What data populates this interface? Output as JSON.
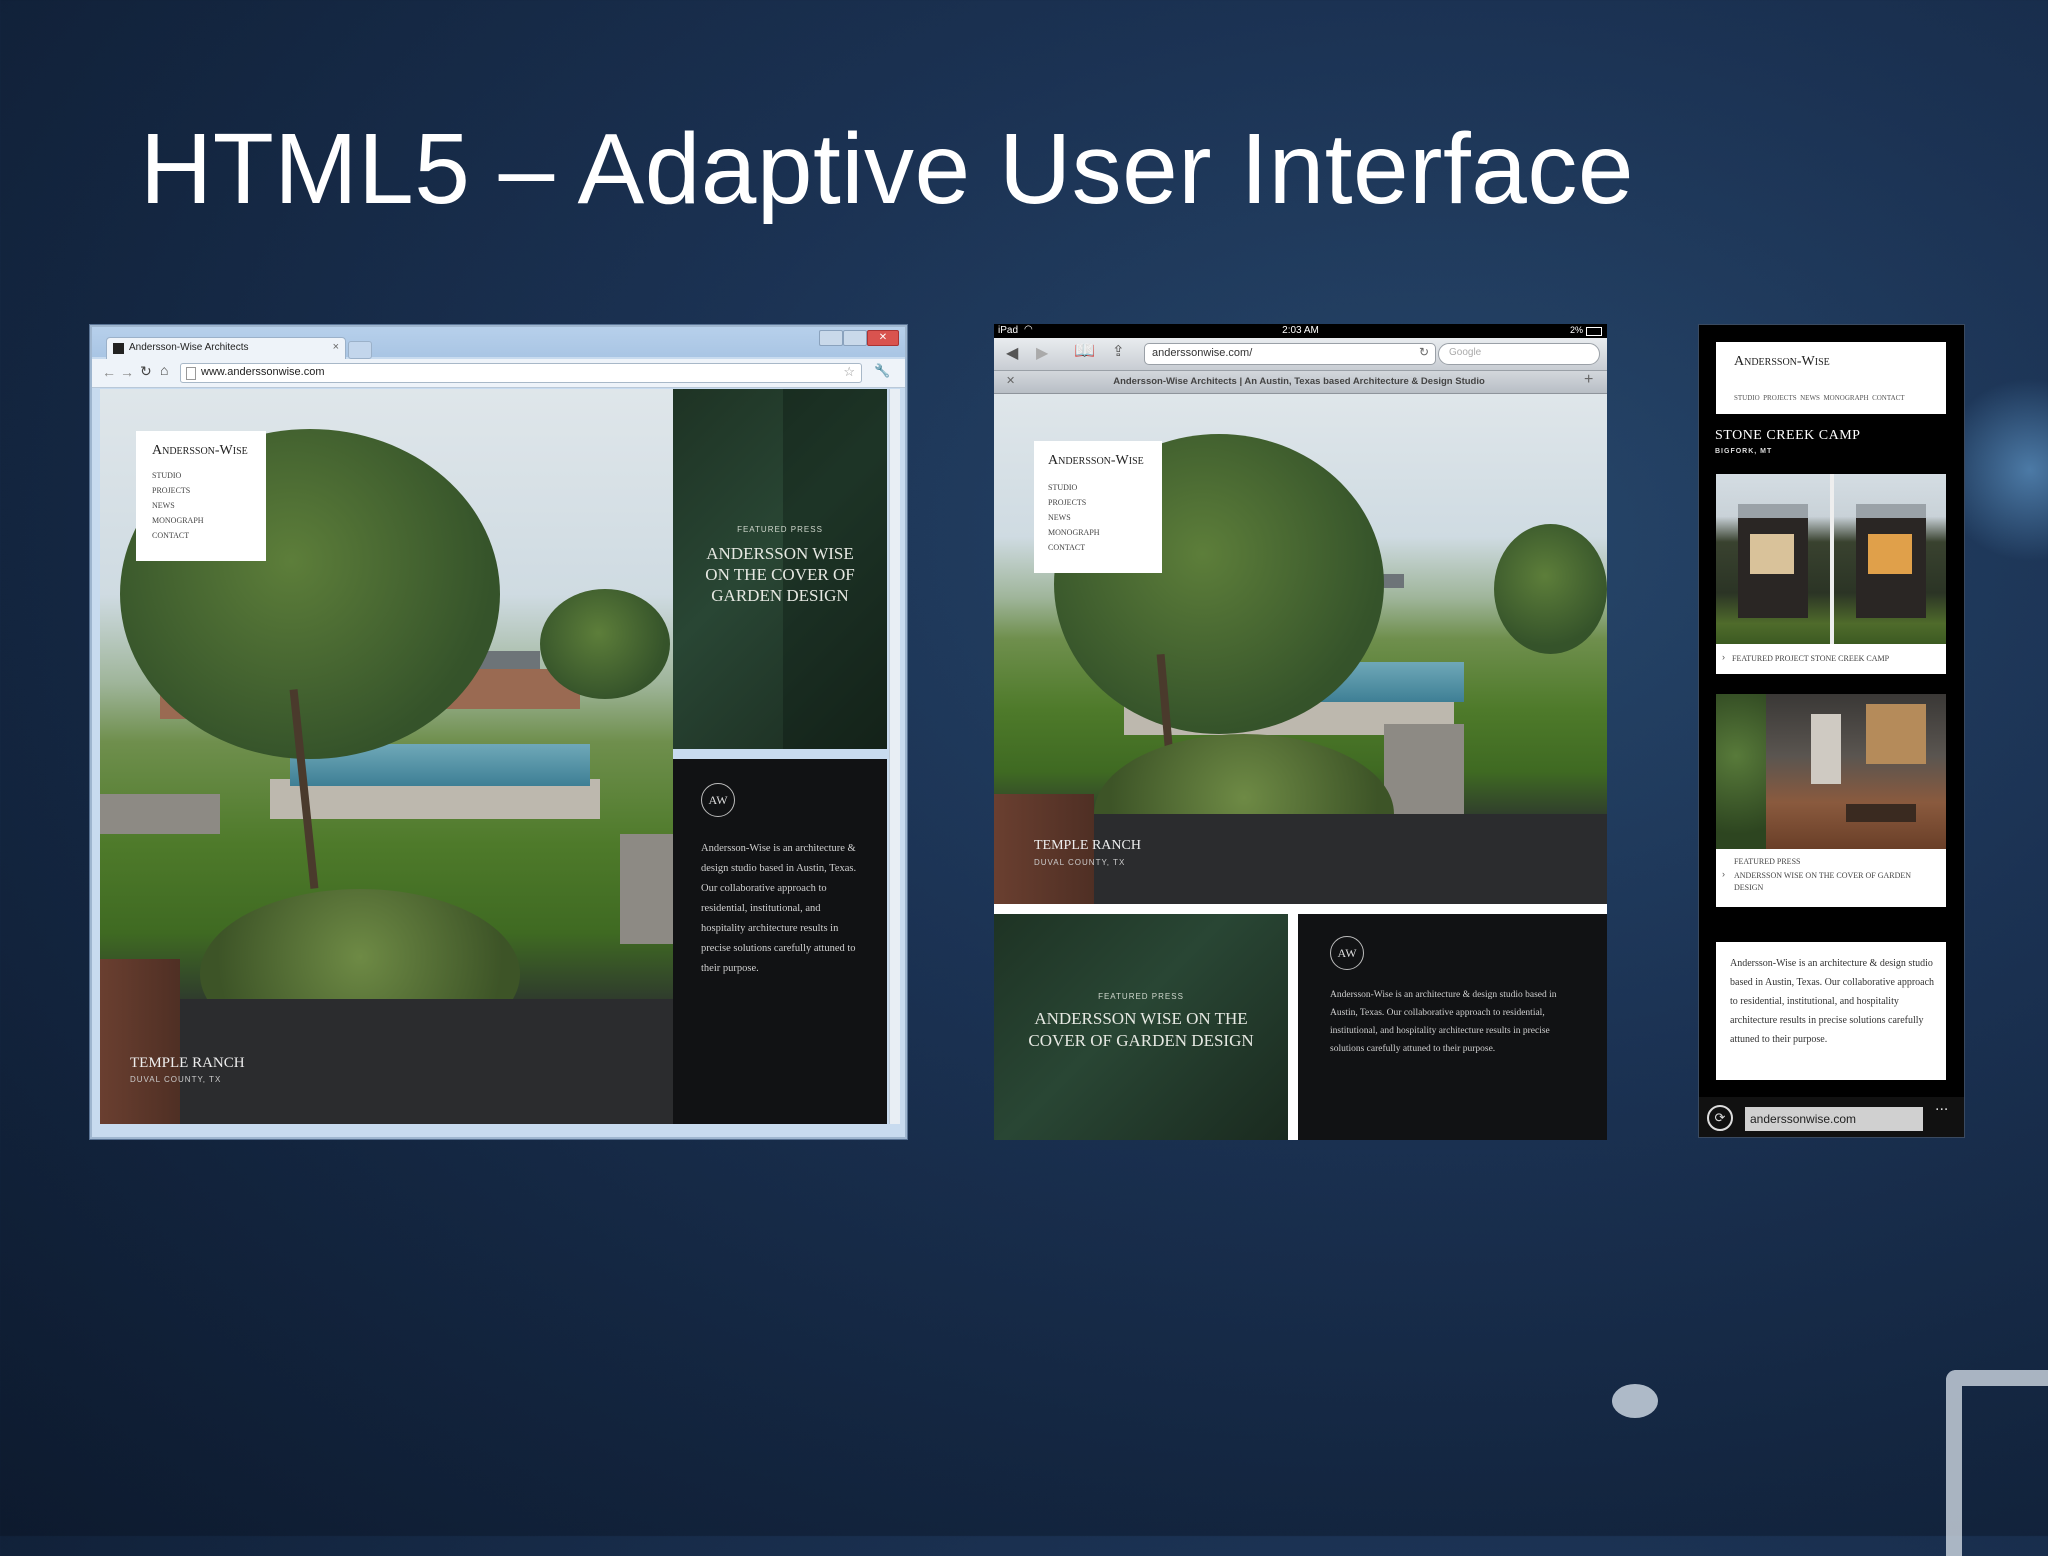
{
  "slide": {
    "title": "HTML5 – Adaptive User Interface"
  },
  "desktop": {
    "tab_title": "Andersson-Wise Architects",
    "address": "www.anderssonwise.com",
    "logo": "Andersson-Wise",
    "nav": [
      "STUDIO",
      "PROJECTS",
      "NEWS",
      "MONOGRAPH",
      "CONTACT"
    ],
    "press_kicker": "FEATURED PRESS",
    "press_headline": "ANDERSSON WISE ON THE COVER OF GARDEN DESIGN",
    "badge": "AW",
    "about": "Andersson-Wise is an architecture & design studio based in Austin, Texas. Our collaborative approach to residential, institutional, and hospitality architecture results in precise solutions carefully attuned to their purpose.",
    "caption_title": "TEMPLE RANCH",
    "caption_sub": "DUVAL COUNTY, TX"
  },
  "tablet": {
    "status_device": "iPad",
    "status_time": "2:03 AM",
    "status_battery": "2%",
    "address": "anderssonwise.com/",
    "search_placeholder": "Google",
    "page_title": "Andersson-Wise Architects | An Austin, Texas based Architecture & Design Studio",
    "logo": "Andersson-Wise",
    "nav": [
      "STUDIO",
      "PROJECTS",
      "NEWS",
      "MONOGRAPH",
      "CONTACT"
    ],
    "caption_title": "TEMPLE RANCH",
    "caption_sub": "DUVAL COUNTY, TX",
    "press_kicker": "FEATURED PRESS",
    "press_headline": "ANDERSSON WISE ON THE COVER OF GARDEN DESIGN",
    "badge": "AW",
    "about": "Andersson-Wise is an architecture & design studio based in Austin, Texas. Our collaborative approach to residential, institutional, and hospitality architecture results in precise solutions carefully attuned to their purpose."
  },
  "phone": {
    "logo": "Andersson-Wise",
    "nav": "STUDIO  PROJECTS  NEWS  MONOGRAPH  CONTACT",
    "project_title": "STONE CREEK CAMP",
    "project_location": "BIGFORK, MT",
    "featured_project": "FEATURED PROJECT STONE CREEK CAMP",
    "press_kicker": "FEATURED PRESS",
    "press_headline": "ANDERSSON WISE ON THE COVER OF GARDEN DESIGN",
    "about": "Andersson-Wise is an architecture & design studio based in Austin, Texas. Our collaborative approach to residential, institutional, and hospitality architecture results in precise solutions carefully attuned to their purpose.",
    "address": "anderssonwise.com",
    "more": "..."
  }
}
